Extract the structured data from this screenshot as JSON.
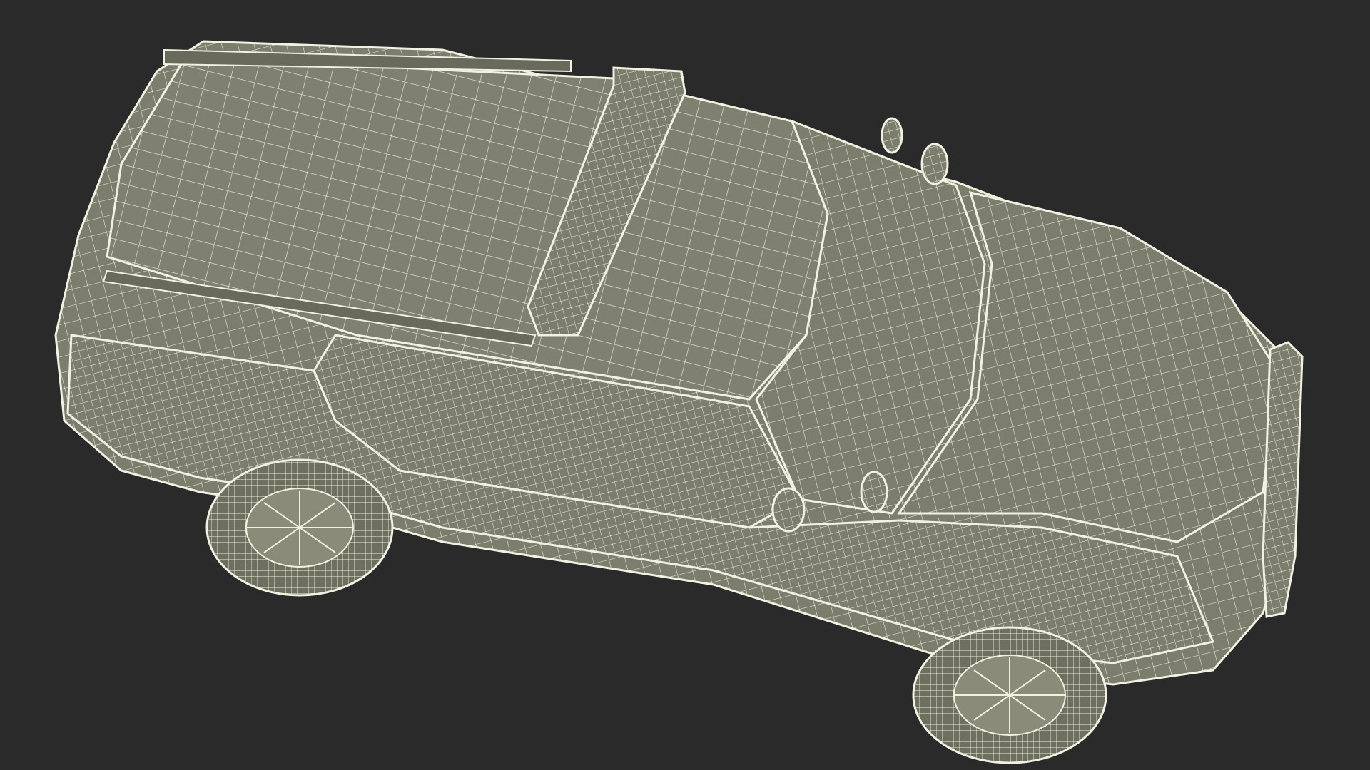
{
  "scene": {
    "subject": "suv-police-wireframe",
    "background_color": "#2a2a2a",
    "mesh_fill_color": "#7d7d6d",
    "mesh_wire_color": "#f1f1e1"
  }
}
